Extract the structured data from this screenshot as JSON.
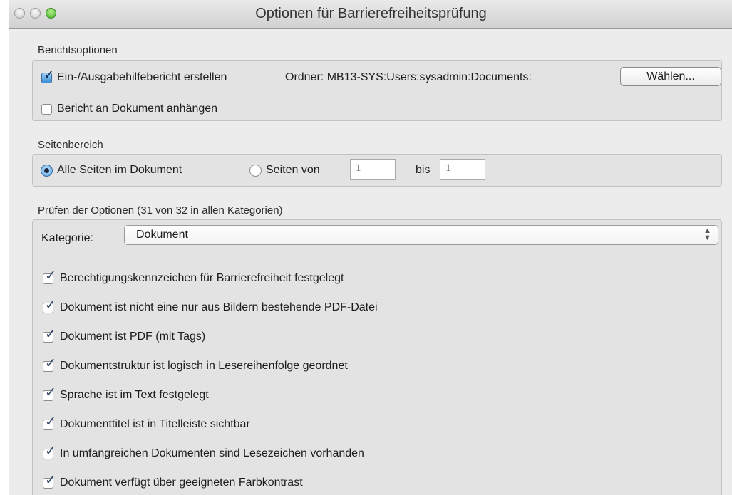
{
  "window": {
    "title": "Optionen für Barrierefreiheitsprüfung"
  },
  "report": {
    "section_label": "Berichtsoptionen",
    "create_report": {
      "label": "Ein-/Ausgabehilfebericht erstellen",
      "checked": true
    },
    "folder_label": "Ordner: MB13-SYS:Users:sysadmin:Documents:",
    "choose_button": "Wählen...",
    "attach_report": {
      "label": "Bericht an Dokument anhängen",
      "checked": false
    }
  },
  "pages": {
    "section_label": "Seitenbereich",
    "all_pages_label": "Alle Seiten im Dokument",
    "pages_from_label": "Seiten von",
    "from_value": "1",
    "to_label": "bis",
    "to_value": "1",
    "selected": "all"
  },
  "checks": {
    "section_label": "Prüfen der Optionen (31 von 32 in allen Kategorien)",
    "category_label": "Kategorie:",
    "category_value": "Dokument",
    "items": [
      {
        "label": "Berechtigungskennzeichen für Barrierefreiheit festgelegt",
        "checked": true
      },
      {
        "label": "Dokument ist nicht eine nur aus Bildern bestehende PDF-Datei",
        "checked": true
      },
      {
        "label": "Dokument ist PDF (mit Tags)",
        "checked": true
      },
      {
        "label": "Dokumentstruktur ist logisch in Lesereihenfolge geordnet",
        "checked": true
      },
      {
        "label": "Sprache ist im Text festgelegt",
        "checked": true
      },
      {
        "label": "Dokumenttitel ist in Titelleiste sichtbar",
        "checked": true
      },
      {
        "label": "In umfangreichen Dokumenten sind Lesezeichen vorhanden",
        "checked": true
      },
      {
        "label": "Dokument verfügt über geeigneten Farbkontrast",
        "checked": true
      }
    ]
  },
  "colors": {
    "accent": "#3d8fd6",
    "window_bg": "#ececec"
  }
}
